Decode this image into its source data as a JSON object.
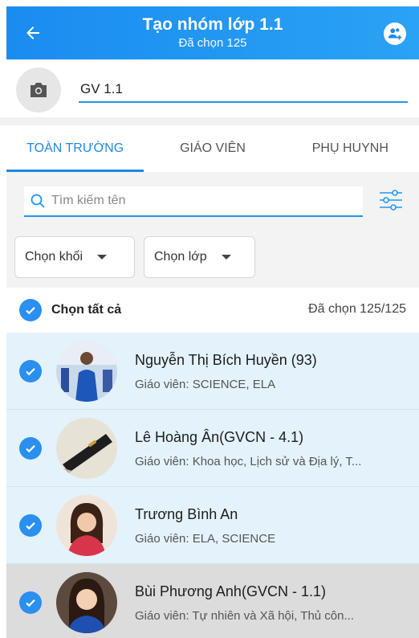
{
  "header": {
    "title": "Tạo nhóm lớp 1.1",
    "subtitle": "Đã chọn 125",
    "colors": {
      "primary": "#1a8cf0",
      "accent": "#2a8ff0"
    }
  },
  "group_name": {
    "value": "GV 1.1"
  },
  "tabs": [
    {
      "label": "TOÀN TRƯỜNG",
      "active": true
    },
    {
      "label": "GIÁO VIÊN",
      "active": false
    },
    {
      "label": "PHỤ HUYNH",
      "active": false
    }
  ],
  "search": {
    "placeholder": "Tìm kiếm tên"
  },
  "filters": {
    "grade_label": "Chọn khối",
    "class_label": "Chọn lớp"
  },
  "select_all": {
    "label": "Chọn tất cả",
    "count": "Đã chọn 125/125"
  },
  "members": [
    {
      "name": "Nguyễn Thị Bích Huyền (93)",
      "detail": "Giáo viên: SCIENCE, ELA",
      "checked": true
    },
    {
      "name": "Lê Hoàng Ân(GVCN - 4.1)",
      "detail": "Giáo viên: Khoa học, Lịch sử và Địa lý, T...",
      "checked": true
    },
    {
      "name": "Trương Bình An",
      "detail": "Giáo viên: ELA, SCIENCE",
      "checked": true
    },
    {
      "name": "Bùi  Phương Anh(GVCN - 1.1)",
      "detail": "Giáo viên: Tự nhiên và Xã hội, Thủ côn...",
      "checked": true
    }
  ],
  "icons": {
    "back": "arrow-left-icon",
    "group_add": "group-add-icon",
    "camera": "camera-icon",
    "search": "search-icon",
    "filter": "sliders-icon",
    "check": "check-circle-icon",
    "dropdown": "caret-down-icon"
  }
}
